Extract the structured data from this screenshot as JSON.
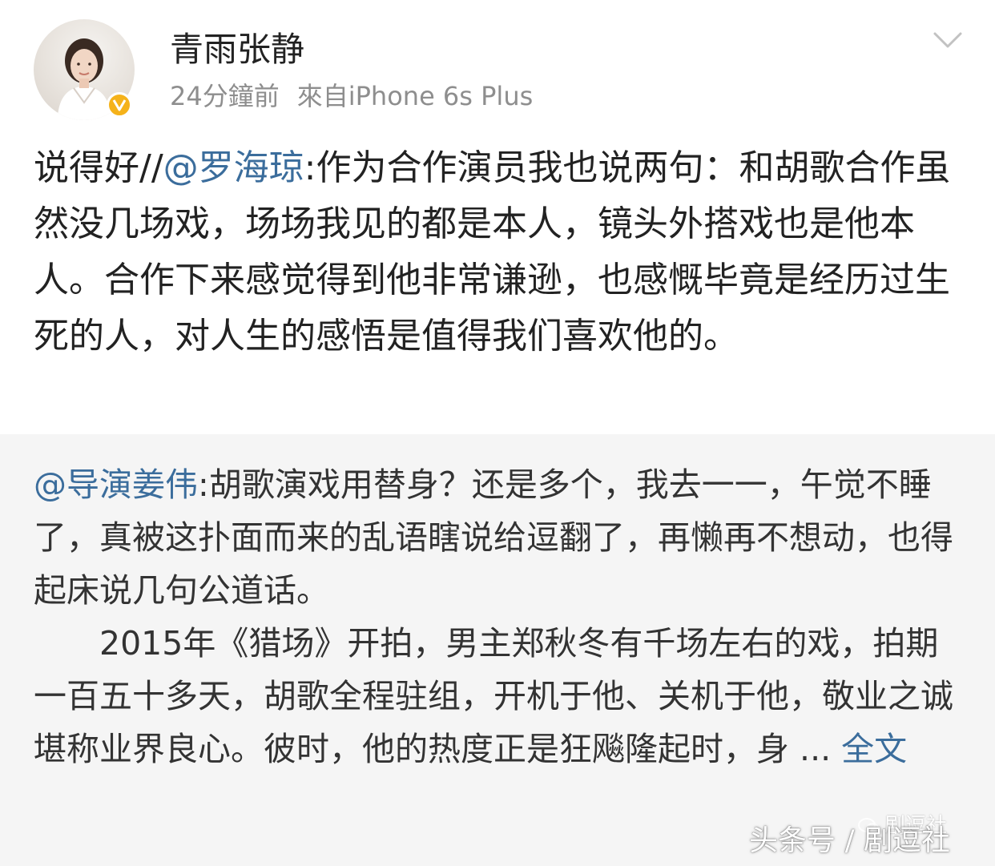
{
  "post": {
    "author": {
      "name": "青雨张静",
      "avatar": "woman-portrait-avatar",
      "verified_badge": "verified-badge-icon",
      "badge_color": "#f5b21a"
    },
    "time": "24分鐘前",
    "source": "來自iPhone 6s Plus",
    "more_icon": "chevron-down-icon",
    "text_prefix": "说得好//",
    "mention": "@罗海琼",
    "text_body": ":作为合作演员我也说两句：和胡歌合作虽然没几场戏，场场我见的都是本人，镜头外搭戏也是他本人。合作下来感觉得到他非常谦逊，也感慨毕竟是经历过生死的人，对人生的感悟是值得我们喜欢他的。"
  },
  "retweet": {
    "mention": "@导演姜伟",
    "para1": ":胡歌演戏用替身？还是多个，我去一一，午觉不睡了，真被这扑面而来的乱语瞎说给逗翻了，再懒再不想动，也得起床说几句公道话。",
    "para2": "2015年《猎场》开拍，男主郑秋冬有千场左右的戏，拍期一百五十多天，胡歌全程驻组，开机于他、关机于他，敬业之诚堪称业界良心。彼时，他的热度正是狂飚隆起时，身 ... ",
    "full_text_link": "全文",
    "background": "#f5f5f5"
  },
  "colors": {
    "link": "#3b6d9c",
    "text": "#222222",
    "meta": "#8e8e8e"
  },
  "watermarks": {
    "wechat": "剧逗社",
    "toutiao": "头条号 / 剧逗社"
  }
}
